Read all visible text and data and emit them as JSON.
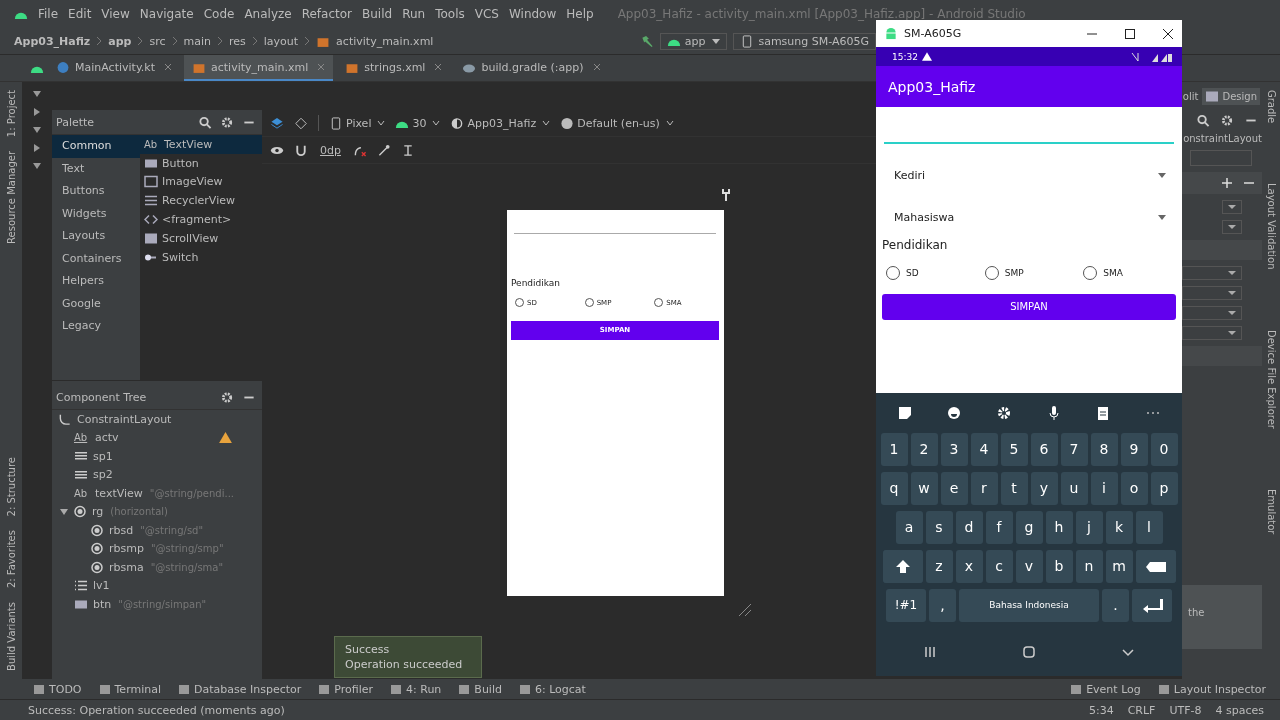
{
  "menu_bar": {
    "items": [
      "File",
      "Edit",
      "View",
      "Navigate",
      "Code",
      "Analyze",
      "Refactor",
      "Build",
      "Run",
      "Tools",
      "VCS",
      "Window",
      "Help"
    ],
    "title": "App03_Hafiz - activity_main.xml [App03_Hafiz.app] - Android Studio"
  },
  "breadcrumb": [
    "App03_Hafiz",
    "app",
    "src",
    "main",
    "res",
    "layout",
    "activity_main.xml"
  ],
  "run_config": "app",
  "device": "samsung SM-A605G",
  "editor_tabs": [
    {
      "label": "MainActivity.kt",
      "kind": "kotlin",
      "selected": false
    },
    {
      "label": "activity_main.xml",
      "kind": "xml",
      "selected": true
    },
    {
      "label": "strings.xml",
      "kind": "xml",
      "selected": false
    },
    {
      "label": "build.gradle (:app)",
      "kind": "gradle",
      "selected": false
    }
  ],
  "left_tool_windows_top": [
    "1: Project",
    "Resource Manager"
  ],
  "left_tool_windows_bottom": [
    "2: Structure",
    "2: Favorites",
    "Build Variants"
  ],
  "palette": {
    "title": "Palette",
    "categories": [
      {
        "label": "Common",
        "selected": true
      },
      {
        "label": "Text",
        "selected": false
      },
      {
        "label": "Buttons",
        "selected": false
      },
      {
        "label": "Widgets",
        "selected": false
      },
      {
        "label": "Layouts",
        "selected": false
      },
      {
        "label": "Containers",
        "selected": false
      },
      {
        "label": "Helpers",
        "selected": false
      },
      {
        "label": "Google",
        "selected": false
      },
      {
        "label": "Legacy",
        "selected": false
      }
    ],
    "items": [
      {
        "label": "TextView",
        "kind": "text",
        "icon_text": "Ab",
        "selected": true
      },
      {
        "label": "Button",
        "kind": "button",
        "selected": false
      },
      {
        "label": "ImageView",
        "kind": "image",
        "selected": false
      },
      {
        "label": "RecyclerView",
        "kind": "list",
        "selected": false
      },
      {
        "label": "<fragment>",
        "kind": "code",
        "selected": false
      },
      {
        "label": "ScrollView",
        "kind": "scroll",
        "selected": false
      },
      {
        "label": "Switch",
        "kind": "switch",
        "selected": false
      }
    ]
  },
  "design_toolbar": {
    "device": "Pixel",
    "api": "30",
    "theme": "App03_Hafiz",
    "locale": "Default (en-us)",
    "margin": "0dp"
  },
  "component_tree": {
    "title": "Component Tree",
    "root": {
      "name": "ConstraintLayout",
      "children": [
        {
          "name": "actv",
          "kind": "autocomplete",
          "icon_text": "Ab",
          "warning": true
        },
        {
          "name": "sp1",
          "kind": "spinner",
          "warning": false
        },
        {
          "name": "sp2",
          "kind": "spinner",
          "warning": false
        },
        {
          "name": "textView",
          "kind": "text",
          "icon_text": "Ab",
          "detail": "\"@string/pendi...",
          "warning": false
        },
        {
          "name": "rg",
          "kind": "radio-group",
          "detail": "(horizontal)",
          "expanded": true,
          "warning": false,
          "children": [
            {
              "name": "rbsd",
              "kind": "radio",
              "detail": "\"@string/sd\""
            },
            {
              "name": "rbsmp",
              "kind": "radio",
              "detail": "\"@string/smp\""
            },
            {
              "name": "rbsma",
              "kind": "radio",
              "detail": "\"@string/sma\""
            }
          ]
        },
        {
          "name": "lv1",
          "kind": "list",
          "warning": false
        },
        {
          "name": "btn",
          "kind": "button",
          "detail": "\"@string/simpan\"",
          "warning": false
        }
      ]
    }
  },
  "preview": {
    "label": "Pendidikan",
    "radios": [
      {
        "label": "SD",
        "selected": false
      },
      {
        "label": "SMP",
        "selected": false
      },
      {
        "label": "SMA",
        "selected": false
      }
    ],
    "button": "SIMPAN"
  },
  "attributes_panel": {
    "mode_split": "olit",
    "mode_design": {
      "label": "Design",
      "selected": true
    },
    "root_label": "onstraintLayout",
    "hint": "the"
  },
  "right_tool_windows": [
    "Gradle",
    "Layout Validation",
    "Device File Explorer",
    "Emulator"
  ],
  "balloon": {
    "title": "Success",
    "message": "Operation succeeded"
  },
  "bottom_tools": [
    "TODO",
    "Terminal",
    "Database Inspector",
    "Profiler",
    "4: Run",
    "Build",
    "6: Logcat"
  ],
  "bottom_tools_right": [
    "Event Log",
    "Layout Inspector"
  ],
  "status_bar": {
    "message": "Success: Operation succeeded (moments ago)",
    "items": [
      "5:34",
      "CRLF",
      "UTF-8",
      "4 spaces"
    ]
  },
  "emulator": {
    "title": "SM-A605G",
    "time": "15:32",
    "app_title": "App03_Hafiz",
    "spinners": [
      "Kediri",
      "Mahasiswa"
    ],
    "label": "Pendidikan",
    "radios": [
      {
        "label": "SD",
        "selected": false
      },
      {
        "label": "SMP",
        "selected": false
      },
      {
        "label": "SMA",
        "selected": false
      }
    ],
    "button": "SIMPAN",
    "keyboard": {
      "rows": [
        [
          "1",
          "2",
          "3",
          "4",
          "5",
          "6",
          "7",
          "8",
          "9",
          "0"
        ],
        [
          "q",
          "w",
          "e",
          "r",
          "t",
          "y",
          "u",
          "i",
          "o",
          "p"
        ],
        [
          "a",
          "s",
          "d",
          "f",
          "g",
          "h",
          "j",
          "k",
          "l"
        ],
        [
          "z",
          "x",
          "c",
          "v",
          "b",
          "n",
          "m"
        ]
      ],
      "symbols": "!#1",
      "comma": ",",
      "space": "Bahasa Indonesia",
      "period": "."
    }
  }
}
